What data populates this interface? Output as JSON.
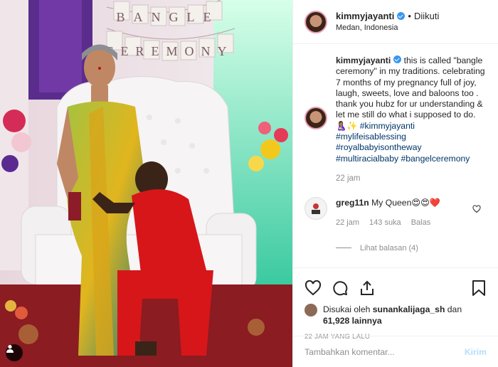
{
  "post": {
    "username": "kimmyjayanti",
    "follow_dot": "•",
    "follow_status": "Diikuti",
    "location": "Medan, Indonesia",
    "photo_banner_line1": "BANGLE",
    "photo_banner_line2": "CEREMONY"
  },
  "caption": {
    "username": "kimmyjayanti",
    "text": " this is called \"bangle ceremony\" in my traditions. celebrating 7 months of my pregnancy full of joy, laugh, sweets, love and baloons too . thank you hubz for ur understanding & let me still do what i supposed to do. 🤱🏽✨",
    "hashtags": [
      "#kimmyjayanti",
      "#mylifeisablessing",
      "#royalbabyisontheway",
      "#multiracialbaby",
      "#bangelceremony"
    ],
    "time": "22 jam"
  },
  "comments": [
    {
      "username": "greg11n",
      "text": "My Queen😍😍❤️",
      "time": "22 jam",
      "likes": "143 suka",
      "reply": "Balas",
      "view_replies": "Lihat balasan (4)"
    }
  ],
  "likes": {
    "prefix": "Disukai oleh ",
    "user": "sunankalijaga_sh",
    "mid": " dan",
    "count": "61,928 lainnya"
  },
  "date": "22 JAM YANG LALU",
  "comment_box": {
    "placeholder": "Tambahkan komentar...",
    "post_label": "Kirim"
  },
  "colors": {
    "accent_blue": "#3897f0",
    "hashtag": "#003569",
    "muted": "#8e8e8e",
    "post_disabled": "#b2dffc"
  }
}
